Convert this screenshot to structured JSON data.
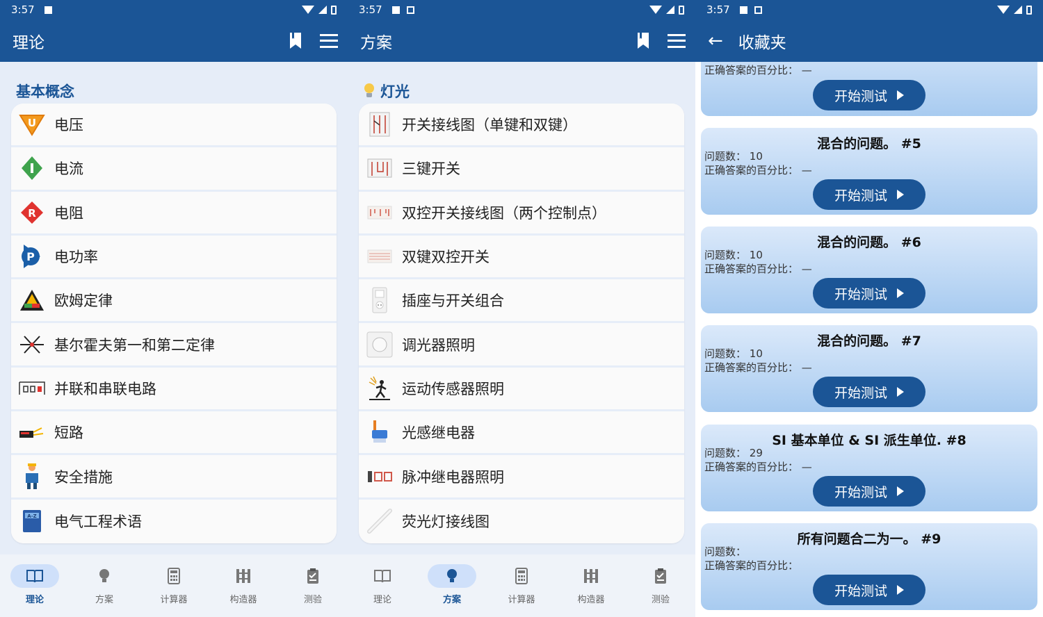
{
  "status": {
    "time": "3:57"
  },
  "screen1": {
    "appbar": {
      "title": "理论"
    },
    "section_title": "基本概念",
    "items": [
      {
        "label": "电压",
        "icon": "voltage-icon"
      },
      {
        "label": "电流",
        "icon": "current-icon"
      },
      {
        "label": "电阻",
        "icon": "resistance-icon"
      },
      {
        "label": "电功率",
        "icon": "power-icon"
      },
      {
        "label": "欧姆定律",
        "icon": "ohms-law-icon"
      },
      {
        "label": "基尔霍夫第一和第二定律",
        "icon": "kirchhoff-icon"
      },
      {
        "label": "并联和串联电路",
        "icon": "circuit-icon"
      },
      {
        "label": "短路",
        "icon": "short-circuit-icon"
      },
      {
        "label": "安全措施",
        "icon": "safety-icon"
      },
      {
        "label": "电气工程术语",
        "icon": "glossary-book-icon"
      }
    ],
    "icon_text": {
      "voltage": "U",
      "resistance": "R",
      "power": "P",
      "book": "A-Z"
    }
  },
  "screen2": {
    "appbar": {
      "title": "方案"
    },
    "section_title": "灯光",
    "items": [
      {
        "label": "开关接线图（单键和双键）",
        "icon": "switch-wiring-icon"
      },
      {
        "label": "三键开关",
        "icon": "three-gang-switch-icon"
      },
      {
        "label": "双控开关接线图（两个控制点）",
        "icon": "two-way-switch-icon"
      },
      {
        "label": "双键双控开关",
        "icon": "double-two-way-switch-icon"
      },
      {
        "label": "插座与开关组合",
        "icon": "socket-switch-icon"
      },
      {
        "label": "调光器照明",
        "icon": "dimmer-icon"
      },
      {
        "label": "运动传感器照明",
        "icon": "motion-sensor-icon"
      },
      {
        "label": "光感继电器",
        "icon": "photo-relay-icon"
      },
      {
        "label": "脉冲继电器照明",
        "icon": "pulse-relay-icon"
      },
      {
        "label": "荧光灯接线图",
        "icon": "fluorescent-lamp-icon"
      }
    ]
  },
  "bottom_nav": [
    {
      "label": "理论",
      "icon": "book-icon"
    },
    {
      "label": "方案",
      "icon": "bulb-icon"
    },
    {
      "label": "计算器",
      "icon": "calculator-icon"
    },
    {
      "label": "构造器",
      "icon": "builder-icon"
    },
    {
      "label": "测验",
      "icon": "quiz-icon"
    }
  ],
  "screen3": {
    "appbar": {
      "title": "收藏夹"
    },
    "cards": [
      {
        "title": "",
        "count_label": "",
        "count": "",
        "percent_label": "正确答案的百分比：",
        "percent": "—",
        "button": "开始测试"
      },
      {
        "title": "混合的问题。 #5",
        "count_label": "问题数：",
        "count": "10",
        "percent_label": "正确答案的百分比：",
        "percent": "—",
        "button": "开始测试"
      },
      {
        "title": "混合的问题。 #6",
        "count_label": "问题数：",
        "count": "10",
        "percent_label": "正确答案的百分比：",
        "percent": "—",
        "button": "开始测试"
      },
      {
        "title": "混合的问题。 #7",
        "count_label": "问题数：",
        "count": "10",
        "percent_label": "正确答案的百分比：",
        "percent": "—",
        "button": "开始测试"
      },
      {
        "title": "SI 基本单位 & SI 派生单位. #8",
        "count_label": "问题数：",
        "count": "29",
        "percent_label": "正确答案的百分比：",
        "percent": "—",
        "button": "开始测试"
      },
      {
        "title": "所有问题合二为一。 #9",
        "count_label": "问题数：",
        "count": "",
        "percent_label": "正确答案的百分比：",
        "percent": "",
        "button": "开始测试"
      }
    ]
  }
}
